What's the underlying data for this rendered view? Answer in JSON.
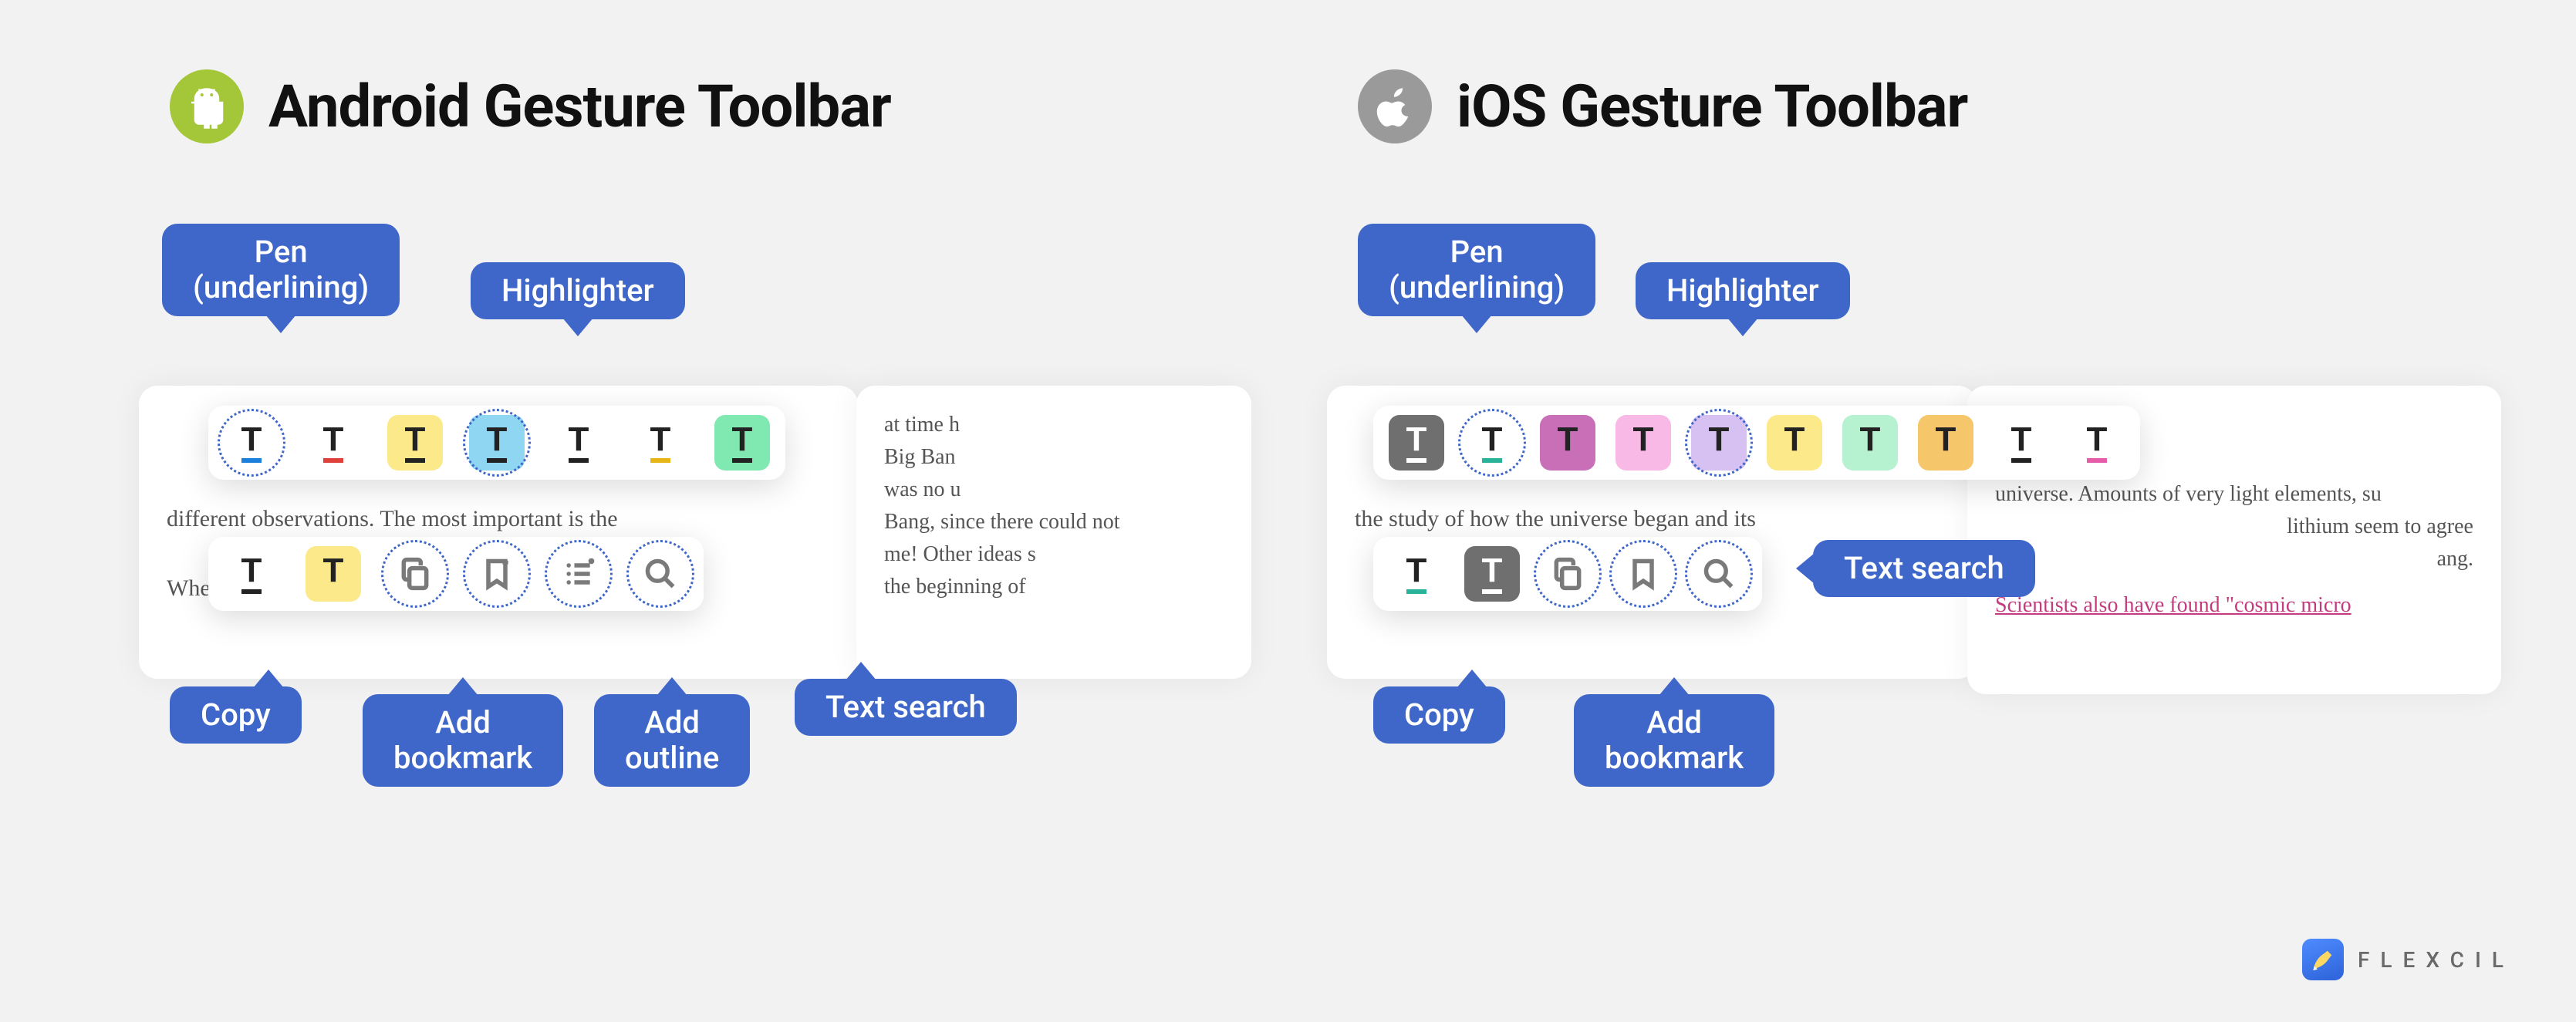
{
  "titles": {
    "android": "Android Gesture Toolbar",
    "ios": "iOS Gesture Toolbar"
  },
  "labels": {
    "pen": "Pen\n(underlining)",
    "highlighter": "Highlighter",
    "copy": "Copy",
    "add_bookmark": "Add\nbookmark",
    "add_outline": "Add\noutline",
    "text_search": "Text search"
  },
  "brand": "FLEXCIL",
  "android": {
    "doc_left": "different observations. The most important is the\n\nWhen an object moves away from Earth, its color",
    "doc_right": "at time h\nBig Ban\nwas no u\nBang, since there could not\nme! Other ideas s\nthe beginning of"
  },
  "ios": {
    "doc_left_line1": "the study of how the universe began and its",
    "doc_right_line1": "universe. Amounts of very light elements, su",
    "doc_right_line2": "lithium seem to agree",
    "doc_right_line3": "ang.",
    "doc_right_line4": "Scientists also have found \"cosmic micro"
  }
}
